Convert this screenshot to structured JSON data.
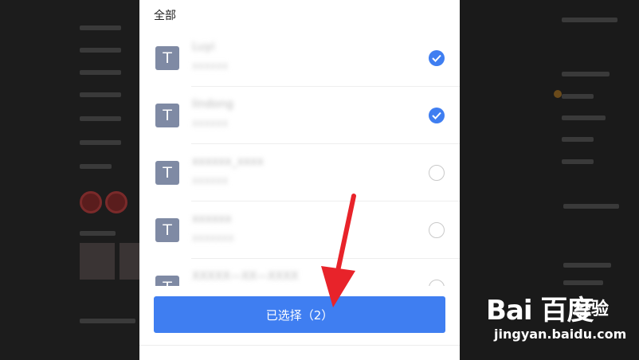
{
  "dialog": {
    "title": "全部",
    "items": [
      {
        "avatar": "T",
        "name": "Luyi",
        "sub": "XXXXXX",
        "checked": true
      },
      {
        "avatar": "T",
        "name": "lindong",
        "sub": "XXXXXX",
        "checked": true
      },
      {
        "avatar": "T",
        "name": "xxxxxx_xxxx",
        "sub": "XXXXXX",
        "checked": false
      },
      {
        "avatar": "T",
        "name": "xxxxxx",
        "sub": "XXXXXXX",
        "checked": false
      },
      {
        "avatar": "T",
        "name": "XXXXX—XX—XXXX",
        "sub": "",
        "checked": false
      }
    ],
    "confirm_label": "已选择（2）"
  },
  "watermark": {
    "logo": "Bai 百度",
    "brand": "经验",
    "url": "jingyan.baidu.com"
  },
  "colors": {
    "accent": "#3f7ef1",
    "annotation": "#e8232a"
  }
}
